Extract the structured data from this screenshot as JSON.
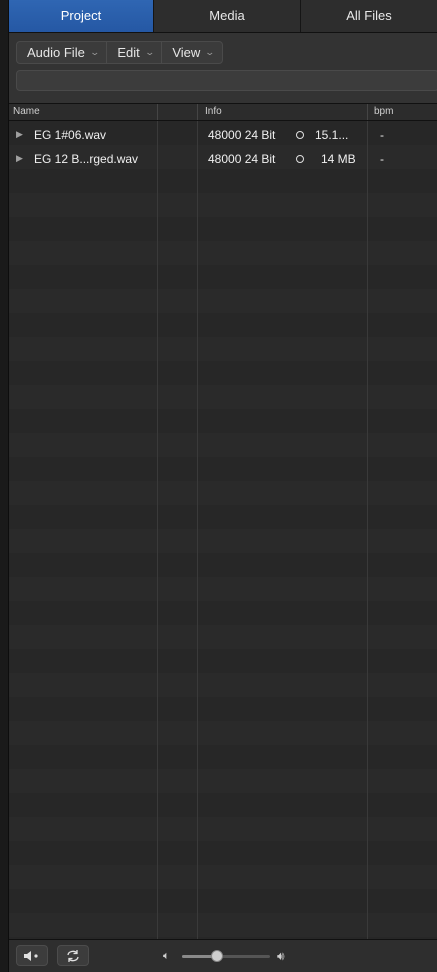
{
  "tabs": [
    {
      "label": "Project",
      "active": true
    },
    {
      "label": "Media",
      "active": false
    },
    {
      "label": "All Files",
      "active": false
    }
  ],
  "toolbar": {
    "menus": [
      "Audio File",
      "Edit",
      "View"
    ],
    "search_value": ""
  },
  "columns": {
    "name": "Name",
    "info": "Info",
    "bpm": "bpm"
  },
  "files": [
    {
      "name": "EG 1#06.wav",
      "info": "48000 24 Bit",
      "size": "15.1...",
      "bpm": "-"
    },
    {
      "name": "EG 12 B...rged.wav",
      "info": "48000 24 Bit",
      "size": "14 MB",
      "bpm": "-"
    }
  ],
  "volume": {
    "level_fraction": 0.4
  },
  "colors": {
    "accent": "#2b60ad",
    "background": "#262626"
  },
  "icons": {
    "disclosure": "triangle-right-icon",
    "speaker_button": "speaker-prelisten-icon",
    "cycle_button": "cycle-loop-icon",
    "volume_low": "volume-low-icon",
    "volume_high": "volume-high-icon"
  }
}
